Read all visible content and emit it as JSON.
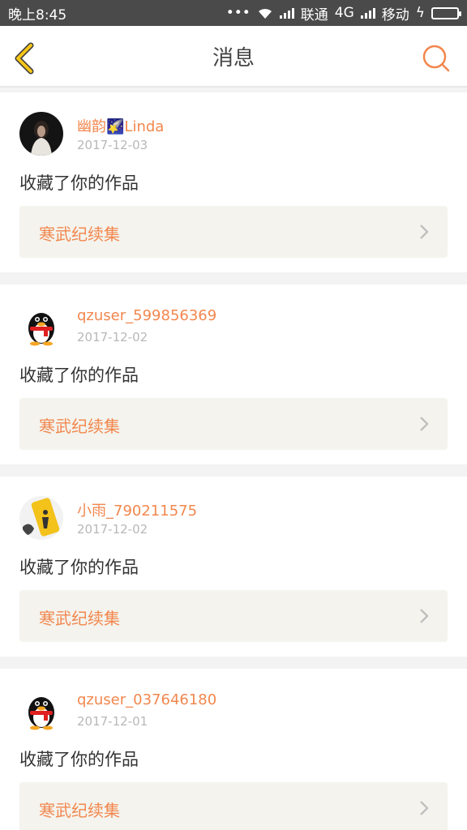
{
  "status_bar": {
    "time": "晚上8:45",
    "dots": "•••",
    "carrier1": "联通",
    "network1": "4G",
    "carrier2": "移动",
    "charging": "ϟ"
  },
  "header": {
    "title": "消息",
    "back_icon": "chevron-left-icon",
    "search_icon": "search-icon"
  },
  "colors": {
    "accent": "#f2874e",
    "back_icon": "#e6b800",
    "status_bar": "#4a4a4a",
    "card_bg": "#f4f3ed"
  },
  "messages": [
    {
      "username": "幽韵🌠Linda",
      "date": "2017-12-03",
      "action": "收藏了你的作品",
      "work_title": "寒武纪续集",
      "avatar": "photo-avatar-dark"
    },
    {
      "username": "qzuser_599856369",
      "date": "2017-12-02",
      "action": "收藏了你的作品",
      "work_title": "寒武纪续集",
      "avatar": "qq-penguin-avatar"
    },
    {
      "username": "小雨_790211575",
      "date": "2017-12-02",
      "action": "收藏了你的作品",
      "work_title": "寒武纪续集",
      "avatar": "photo-avatar-yellow"
    },
    {
      "username": "qzuser_037646180",
      "date": "2017-12-01",
      "action": "收藏了你的作品",
      "work_title": "寒武纪续集",
      "avatar": "qq-penguin-avatar"
    }
  ]
}
